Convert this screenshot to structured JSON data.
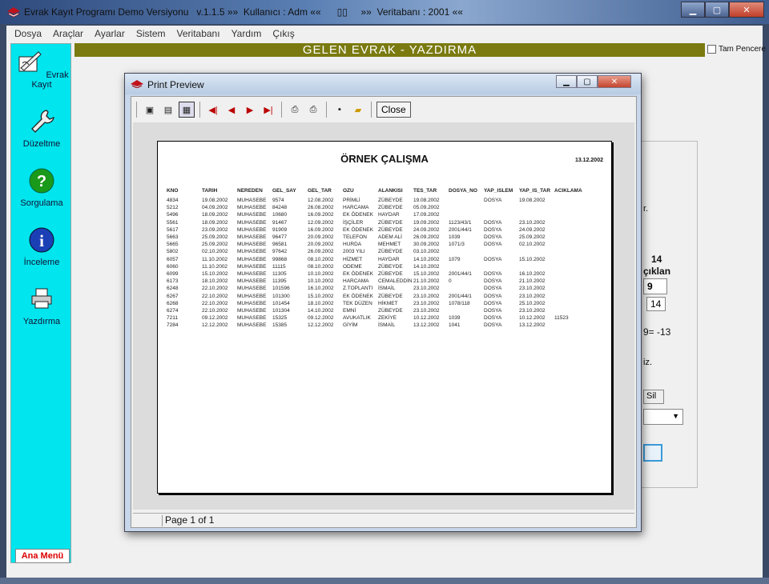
{
  "window": {
    "title": "Evrak Kayıt Programı Demo Versiyonu   v.1.1.5 »»  Kullanıcı : Adm ««      ▯▯     »»  Veritabanı : 2001 ««"
  },
  "menu": [
    "Dosya",
    "Araçlar",
    "Ayarlar",
    "Sistem",
    "Veritabanı",
    "Yardım",
    "Çıkış"
  ],
  "sidebar": {
    "items": [
      {
        "label": "Evrak Kayıt",
        "icon": "pen-paper-icon"
      },
      {
        "label": "Düzeltme",
        "icon": "wrench-icon"
      },
      {
        "label": "Sorgulama",
        "icon": "question-icon"
      },
      {
        "label": "İnceleme",
        "icon": "info-icon"
      },
      {
        "label": "Yazdırma",
        "icon": "printer-icon"
      }
    ],
    "ana_menu": "Ana Menü"
  },
  "header": {
    "title": "GELEN EVRAK - YAZDIRMA",
    "fullscreen_label": "Tam Pencere"
  },
  "background_panel": {
    "r_text": "r.",
    "num14": "14",
    "ciklan": "çıklan",
    "box9": "9",
    "box14": "14",
    "eq": "9=  -13",
    "iz": "iz.",
    "sil": "Sil"
  },
  "print_preview": {
    "title": "Print Preview",
    "close_label": "Close",
    "status": "Page 1 of 1"
  },
  "report": {
    "title": "ÖRNEK ÇALIŞMA",
    "date": "13.12.2002",
    "columns": [
      "KNO",
      "TARIH",
      "NEREDEN",
      "GEL_SAY",
      "GEL_TAR",
      "OZU",
      "ALANKISI",
      "TES_TAR",
      "DOSYA_NO",
      "YAP_ISLEM",
      "YAP_IS_TAR",
      "ACIKLAMA"
    ],
    "rows": [
      [
        "4834",
        "19.08.2002",
        "MUHASEBE",
        "9574",
        "12.08.2002",
        "PRİMLİ",
        "ZÜBEYDE",
        "19.08.2002",
        "",
        "DOSYA",
        "19.08.2002",
        ""
      ],
      [
        "5212",
        "04.09.2002",
        "MUHASEBE",
        "84248",
        "26.08.2002",
        "HARCAMA",
        "ZÜBEYDE",
        "05.09.2002",
        "",
        "",
        "",
        ""
      ],
      [
        "5496",
        "18.09.2002",
        "MUHASEBE",
        "10680",
        "16.09.2002",
        "EK ÖDENEK",
        "HAYDAR",
        "17.09.2002",
        "",
        "",
        "",
        ""
      ],
      [
        "5561",
        "18.09.2002",
        "MUHASEBE",
        "91467",
        "12.09.2002",
        "İŞÇİLER",
        "ZÜBEYDE",
        "19.09.2002",
        "1123/43/1",
        "DOSYA",
        "23.10.2002",
        ""
      ],
      [
        "5617",
        "23.09.2002",
        "MUHASEBE",
        "91909",
        "16.09.2002",
        "EK ÖDENEK",
        "ZÜBEYDE",
        "24.09.2002",
        "2001/44/1",
        "DOSYA",
        "24.09.2002",
        ""
      ],
      [
        "5663",
        "25.09.2002",
        "MUHASEBE",
        "96477",
        "20.09.2002",
        "TELEFON",
        "ADEM ALİ",
        "26.09.2002",
        "1039",
        "DOSYA",
        "25.09.2002",
        ""
      ],
      [
        "5665",
        "25.09.2002",
        "MUHASEBE",
        "96581",
        "20.09.2002",
        "HURDA",
        "MEHMET",
        "30.09.2002",
        "1071/3",
        "DOSYA",
        "02.10.2002",
        ""
      ],
      [
        "5802",
        "02.10.2002",
        "MUHASEBE",
        "97642",
        "26.09.2002",
        "2003 YILI",
        "ZÜBEYDE",
        "03.10.2002",
        "",
        "",
        "",
        ""
      ],
      [
        "6057",
        "11.10.2002",
        "MUHASEBE",
        "99868",
        "08.10.2002",
        "HİZMET",
        "HAYDAR",
        "14.10.2002",
        "1079",
        "DOSYA",
        "15.10.2002",
        ""
      ],
      [
        "6060",
        "11.10.2002",
        "MUHASEBE",
        "11115",
        "08.10.2002",
        "ODEME",
        "ZÜBEYDE",
        "14.10.2002",
        "",
        "",
        "",
        ""
      ],
      [
        "6099",
        "15.10.2002",
        "MUHASEBE",
        "11305",
        "10.10.2002",
        "EK ÖDENEK",
        "ZÜBEYDE",
        "15.10.2002",
        "2001/44/1",
        "DOSYA",
        "16.10.2002",
        ""
      ],
      [
        "6173",
        "18.10.2002",
        "MUHASEBE",
        "11395",
        "10.10.2002",
        "HARCAMA",
        "CEMALEDDİN",
        "21.10.2002",
        "0",
        "DOSYA",
        "21.10.2002",
        ""
      ],
      [
        "6248",
        "22.10.2002",
        "MUHASEBE",
        "101596",
        "16.10.2002",
        "Z.TOPLANTI",
        "İSMAİL",
        "23.10.2002",
        "",
        "DOSYA",
        "23.10.2002",
        ""
      ],
      [
        "6267",
        "22.10.2002",
        "MUHASEBE",
        "101300",
        "15.10.2002",
        "EK ÖDENEK",
        "ZÜBEYDE",
        "23.10.2002",
        "2001/44/1",
        "DOSYA",
        "23.10.2002",
        ""
      ],
      [
        "6268",
        "22.10.2002",
        "MUHASEBE",
        "101454",
        "18.10.2002",
        "TEK DÜZEN",
        "HİKMET",
        "23.10.2002",
        "1078/118",
        "DOSYA",
        "25.10.2002",
        ""
      ],
      [
        "6274",
        "22.10.2002",
        "MUHASEBE",
        "101304",
        "14.10.2002",
        "EMNİ",
        "ZÜBEYDE",
        "23.10.2002",
        "",
        "DOSYA",
        "23.10.2002",
        ""
      ],
      [
        "7211",
        "09.12.2002",
        "MUHASEBE",
        "15325",
        "09.12.2002",
        "AVUKATLIK",
        "ZEKİYE",
        "10.12.2002",
        "1039",
        "DOSYA",
        "10.12.2002",
        "11523"
      ],
      [
        "7284",
        "12.12.2002",
        "MUHASEBE",
        "15385",
        "12.12.2002",
        "GİYİM",
        "İSMAİL",
        "13.12.2002",
        "1041",
        "DOSYA",
        "13.12.2002",
        ""
      ]
    ]
  },
  "colors": {
    "sidebar": "#00e5ee",
    "header_strip": "#7a7a10",
    "ana_menu_text": "#dd0000"
  }
}
